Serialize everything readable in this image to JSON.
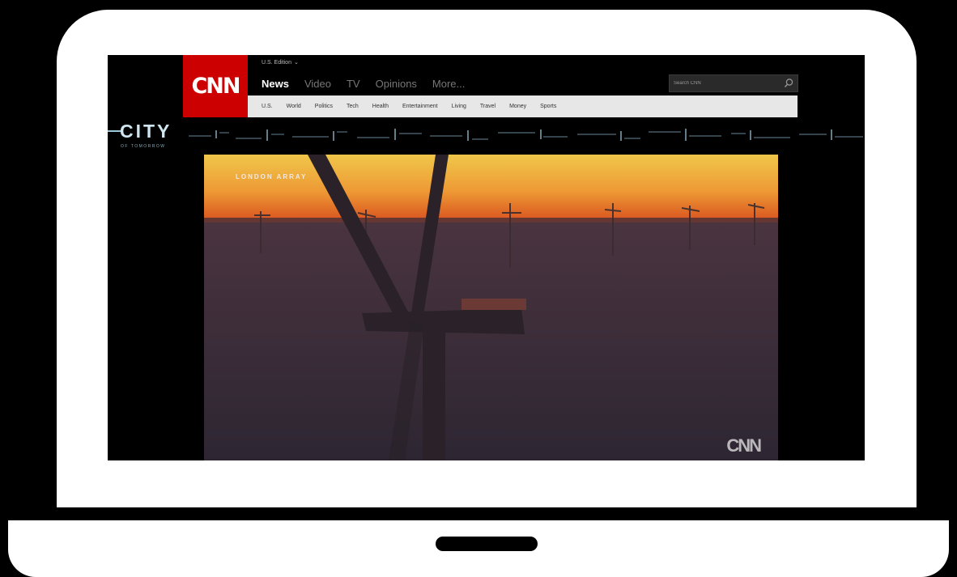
{
  "header": {
    "logo_text": "CNN",
    "edition_label": "U.S. Edition",
    "nav": [
      "News",
      "Video",
      "TV",
      "Opinions",
      "More..."
    ],
    "search_placeholder": "Search CNN"
  },
  "subnav": [
    "U.S.",
    "World",
    "Politics",
    "Tech",
    "Health",
    "Entertainment",
    "Living",
    "Travel",
    "Money",
    "Sports"
  ],
  "banner": {
    "title": "CITY",
    "subtitle": "OF TOMORROW"
  },
  "video": {
    "caption": "LONDON ARRAY",
    "watermark": "CNN"
  },
  "colors": {
    "brand_red": "#cc0000",
    "frame": "#ffffff"
  }
}
